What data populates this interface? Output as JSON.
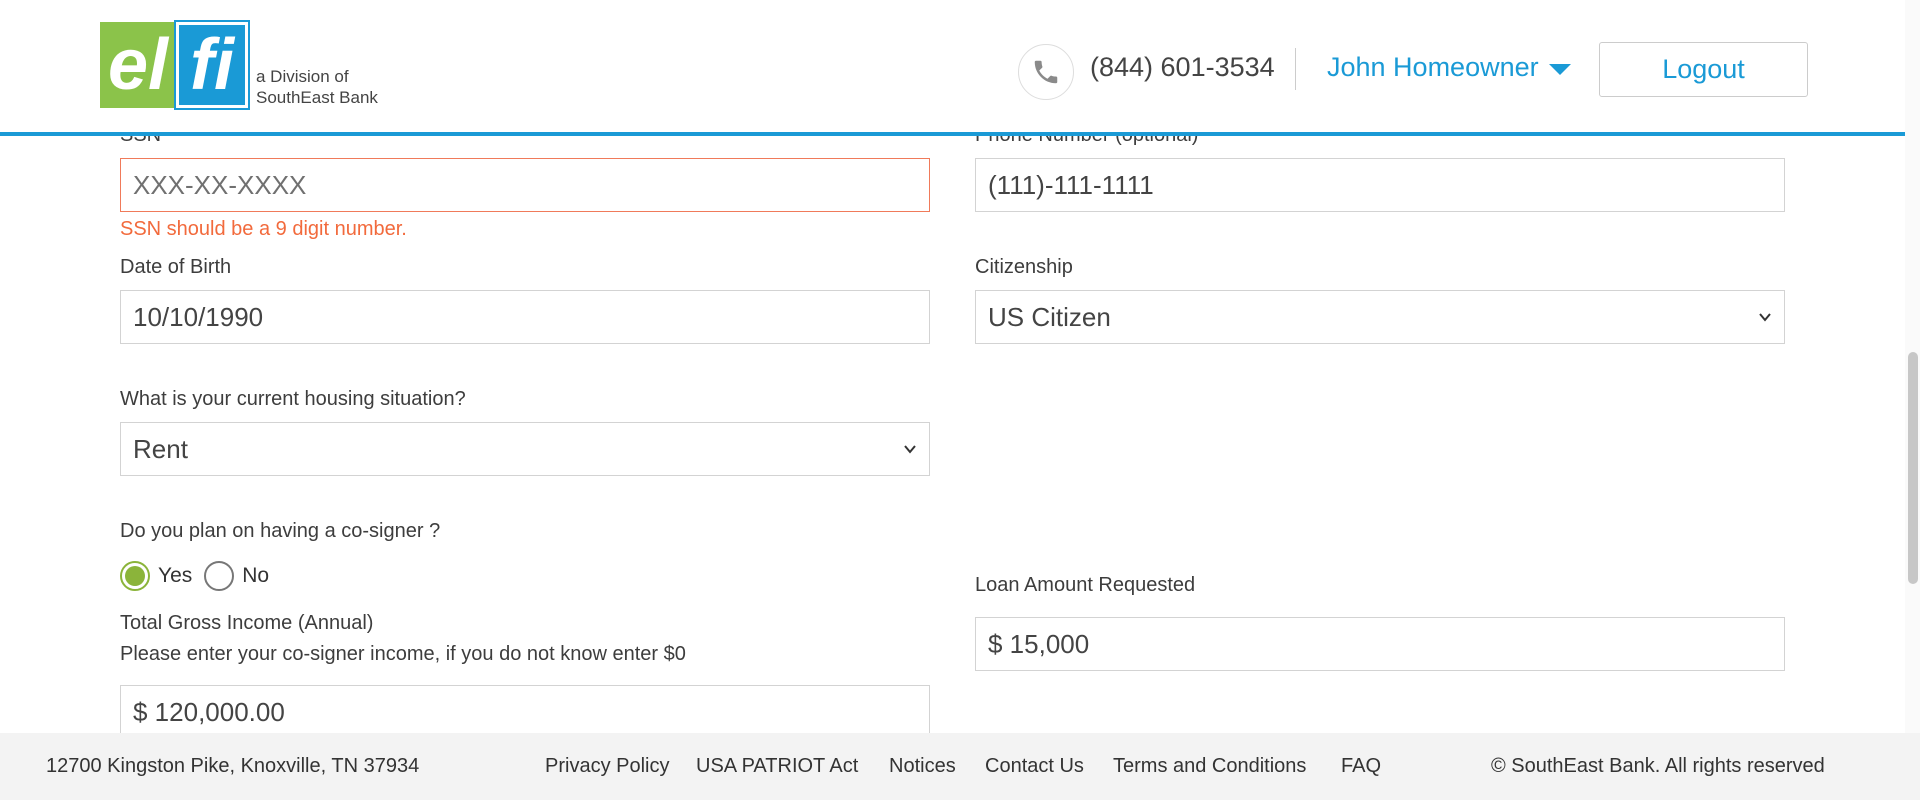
{
  "header": {
    "logo_text_left": "el",
    "logo_text_right": "fi",
    "logo_sub_line1": "a Division of",
    "logo_sub_line2": "SouthEast Bank",
    "phone": "(844) 601-3534",
    "user_name": "John Homeowner",
    "logout_label": "Logout"
  },
  "form": {
    "ssn": {
      "label": "SSN",
      "placeholder": "XXX-XX-XXXX",
      "error": "SSN should be a 9 digit number."
    },
    "phone": {
      "label": "Phone Number (optional)",
      "value": "(111)-111-1111"
    },
    "dob": {
      "label": "Date of Birth",
      "value": "10/10/1990"
    },
    "citizenship": {
      "label": "Citizenship",
      "value": "US Citizen"
    },
    "housing": {
      "label": "What is your current housing situation?",
      "value": "Rent"
    },
    "cosigner": {
      "label": "Do you plan on having a co-signer ?",
      "yes": "Yes",
      "no": "No",
      "selected": "Yes"
    },
    "income": {
      "label": "Total Gross Income (Annual)",
      "help": "Please enter your co-signer income, if you do not know enter $0",
      "value": "$ 120,000.00"
    },
    "loan": {
      "label": "Loan Amount Requested",
      "value": "$ 15,000"
    }
  },
  "footer": {
    "address": "12700 Kingston Pike, Knoxville, TN 37934",
    "links": [
      "Privacy Policy",
      "USA PATRIOT Act",
      "Notices",
      "Contact Us",
      "Terms and Conditions",
      "FAQ"
    ],
    "copyright": "© SouthEast Bank. All rights reserved"
  },
  "colors": {
    "brand_blue": "#1a9ad6",
    "brand_green": "#8bc34a",
    "error": "#f26a3c"
  }
}
